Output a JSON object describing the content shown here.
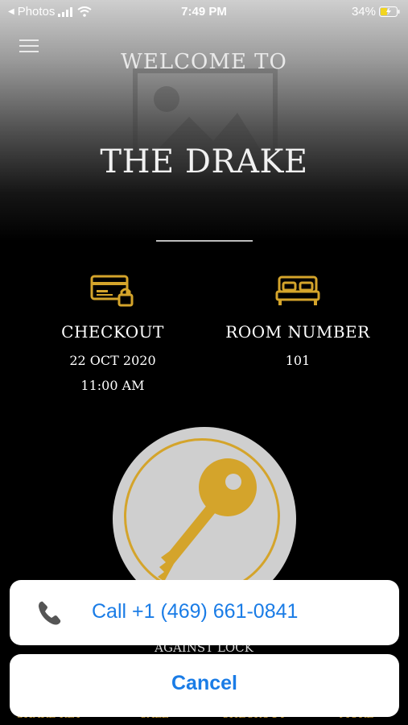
{
  "status_bar": {
    "back_app": "Photos",
    "time": "7:49 PM",
    "battery": "34%"
  },
  "header": {
    "welcome": "WELCOME TO",
    "hotel_name": "THE DRAKE"
  },
  "info": {
    "checkout_label": "CHECKOUT",
    "checkout_date": "22 OCT 2020",
    "checkout_time": "11:00 AM",
    "room_label": "ROOM NUMBER",
    "room_number": "101"
  },
  "key": {
    "hint": "AGAINST LOCK"
  },
  "tabs": [
    {
      "label": "SHARE KEY"
    },
    {
      "label": "CALL"
    },
    {
      "label": "CHECKOUT"
    },
    {
      "label": "MORE"
    }
  ],
  "action_sheet": {
    "call_label": "Call +1 (469) 661-0841",
    "cancel_label": "Cancel"
  },
  "colors": {
    "accent_gold": "#d4a42b",
    "ios_blue": "#1a7ce6"
  }
}
